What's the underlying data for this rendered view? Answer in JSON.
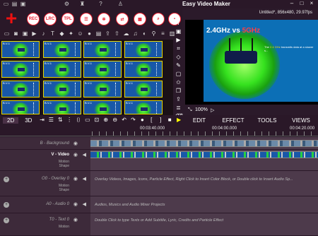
{
  "app": {
    "title": "Easy Video Maker",
    "project_info": "Untitled*, 856x480, 29.97fps"
  },
  "toolbar": {
    "buttons": [
      "REC",
      "LRC",
      "TPL"
    ]
  },
  "thumbnails": {
    "label": "B-V-1"
  },
  "preview": {
    "headline_a": "2.4GHz vs ",
    "headline_b": "5GHz",
    "body_prefix": "The ",
    "body_highlight": "2.4 GHz",
    "body_suffix": " transmits data at a slower s...",
    "zoom": "100%"
  },
  "menu": {
    "items": [
      "EDIT",
      "EFFECT",
      "TOOLS",
      "VIEWS"
    ]
  },
  "tabs": {
    "items": [
      "2D",
      "3D"
    ]
  },
  "ruler": {
    "times": [
      "00:03:40.000",
      "00:04:00.000",
      "00:04:20.000"
    ]
  },
  "tracks": [
    {
      "name": "B - Background",
      "sub": "",
      "hint": ""
    },
    {
      "name": "V - Video",
      "sub": "Motion\nShape",
      "hint": ""
    },
    {
      "name": "O0 - Overlay 0",
      "sub": "Motion\nShape",
      "hint": "Overlay Videos, Images, Icons, Particle Effect, Right Click to Insert Color Block, or Double click to Insert Audio Sp..."
    },
    {
      "name": "A0 - Audio 0",
      "sub": "",
      "hint": "Audios, Musics and Audio Mixer Projects"
    },
    {
      "name": "T0 - Text 0",
      "sub": "Motion",
      "hint": "Double Click to type Texts or Add Subtitle, Lyric, Credits and Particle Effect"
    }
  ]
}
